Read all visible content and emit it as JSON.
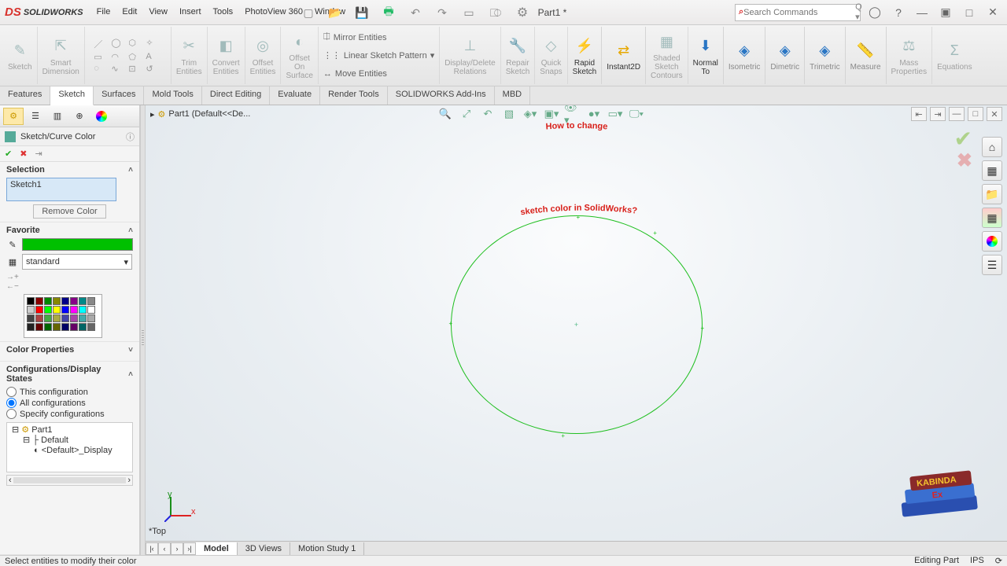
{
  "app": {
    "name": "SOLIDWORKS",
    "doc_title": "Part1 *",
    "search_placeholder": "Search Commands"
  },
  "menu": [
    "File",
    "Edit",
    "View",
    "Insert",
    "Tools",
    "PhotoView 360",
    "Window"
  ],
  "ribbon": {
    "groups": [
      {
        "label": "Sketch"
      },
      {
        "label": "Smart\nDimension"
      },
      {
        "label": "Trim\nEntities"
      },
      {
        "label": "Convert\nEntities"
      },
      {
        "label": "Offset\nEntities"
      },
      {
        "label": "Offset\nOn\nSurface"
      }
    ],
    "tools": [
      "Mirror Entities",
      "Linear Sketch Pattern",
      "Move Entities"
    ],
    "right": [
      {
        "label": "Display/Delete\nRelations"
      },
      {
        "label": "Repair\nSketch"
      },
      {
        "label": "Quick\nSnaps"
      },
      {
        "label": "Rapid\nSketch",
        "accent": true
      },
      {
        "label": "Instant2D",
        "accent": true
      },
      {
        "label": "Shaded\nSketch\nContours"
      },
      {
        "label": "Normal\nTo",
        "accent": true
      },
      {
        "label": "Isometric"
      },
      {
        "label": "Dimetric"
      },
      {
        "label": "Trimetric"
      },
      {
        "label": "Measure"
      },
      {
        "label": "Mass\nProperties"
      },
      {
        "label": "Equations"
      }
    ]
  },
  "tabs": [
    "Features",
    "Sketch",
    "Surfaces",
    "Mold Tools",
    "Direct Editing",
    "Evaluate",
    "Render Tools",
    "SOLIDWORKS Add-Ins",
    "MBD"
  ],
  "active_tab": "Sketch",
  "panel": {
    "title": "Sketch/Curve Color",
    "sections": {
      "selection": {
        "title": "Selection",
        "value": "Sketch1",
        "remove": "Remove Color"
      },
      "favorite": {
        "title": "Favorite",
        "dropdown": "standard",
        "color": "#00c000"
      },
      "color_props": {
        "title": "Color Properties"
      },
      "configs": {
        "title": "Configurations/Display States",
        "opts": [
          "This configuration",
          "All configurations",
          "Specify configurations"
        ],
        "selected": 1,
        "tree": [
          "Part1",
          "Default",
          "<Default>_Display"
        ]
      }
    },
    "swatches": [
      "#000",
      "#800",
      "#080",
      "#880",
      "#008",
      "#808",
      "#088",
      "#888",
      "#ccc",
      "#f00",
      "#0f0",
      "#ff0",
      "#00f",
      "#f0f",
      "#0ff",
      "#fff",
      "#444",
      "#a44",
      "#4a4",
      "#aa4",
      "#44a",
      "#a4a",
      "#4aa",
      "#aaa",
      "#222",
      "#600",
      "#060",
      "#660",
      "#006",
      "#606",
      "#066",
      "#666"
    ]
  },
  "viewport": {
    "breadcrumb": "Part1  (Default<<De...",
    "triad": "*Top",
    "overlay_line1": "How to change",
    "overlay_line2": "sketch color in SolidWorks?"
  },
  "bottom_tabs": [
    "Model",
    "3D Views",
    "Motion Study 1"
  ],
  "status": {
    "left": "Select entities to modify their color",
    "right": "Editing Part",
    "ips": "IPS"
  },
  "watermark": "KABINDA"
}
